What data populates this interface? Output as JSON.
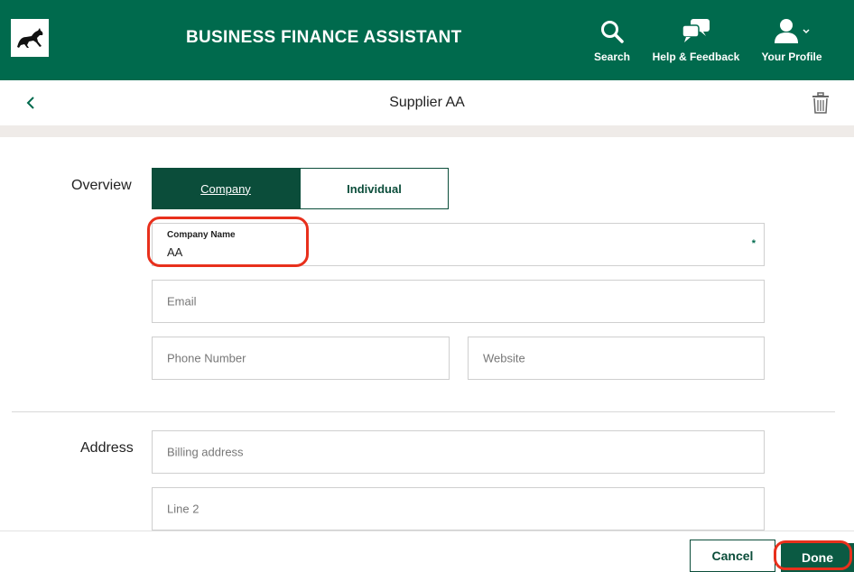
{
  "header": {
    "app_title": "BUSINESS FINANCE ASSISTANT",
    "nav": {
      "search": "Search",
      "help": "Help & Feedback",
      "profile": "Your Profile"
    }
  },
  "subheader": {
    "title": "Supplier AA"
  },
  "overview": {
    "label": "Overview",
    "tabs": {
      "company": "Company",
      "individual": "Individual"
    },
    "company_name": {
      "label": "Company Name",
      "value": "AA",
      "required_mark": "*"
    },
    "email_placeholder": "Email",
    "phone_placeholder": "Phone Number",
    "website_placeholder": "Website"
  },
  "address": {
    "label": "Address",
    "billing_placeholder": "Billing address",
    "line2_placeholder": "Line 2"
  },
  "footer": {
    "cancel": "Cancel",
    "done": "Done"
  },
  "colors": {
    "brand_green": "#006a4d",
    "dark_green": "#0b4d3a",
    "highlight_red": "#e8301c"
  }
}
